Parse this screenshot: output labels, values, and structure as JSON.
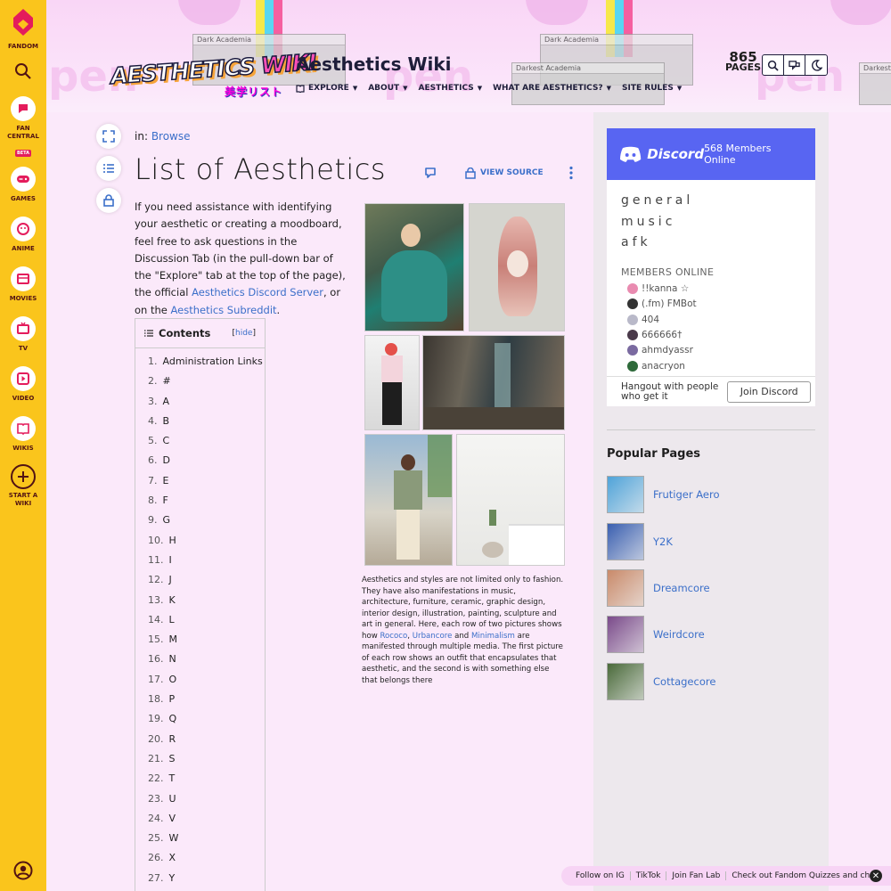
{
  "rail": {
    "fandom_label": "FANDOM",
    "fan_central_label": "FAN CENTRAL",
    "beta_badge": "BETA",
    "games_label": "GAMES",
    "anime_label": "ANIME",
    "movies_label": "MOVIES",
    "tv_label": "TV",
    "video_label": "VIDEO",
    "wikis_label": "WIKIS",
    "start_wiki_label": "START A WIKI"
  },
  "header": {
    "logo_text_a": "AESTHETICS",
    "logo_text_b": "WIKI",
    "logo_sub": "美学リスト",
    "wiki_name": "Aesthetics Wiki",
    "nav": {
      "explore": "EXPLORE",
      "about": "ABOUT",
      "aesthetics": "AESTHETICS",
      "what_are": "WHAT ARE AESTHETICS?",
      "site_rules": "SITE RULES"
    },
    "pages_count": "865",
    "pages_label": "PAGES",
    "deco_window_1": "Dark Academia",
    "deco_window_2": "Dark Academia",
    "deco_window_3": "Darkest Academia",
    "deco_window_4": "Darkest"
  },
  "article": {
    "breadcrumb_prefix": "in:",
    "breadcrumb_link": "Browse",
    "title": "List of Aesthetics",
    "view_source": "VIEW SOURCE",
    "intro_text": "If you need assistance with identifying your aesthetic or creating a moodboard, feel free to ask questions in the Discussion Tab (in the pull-down bar of the \"Explore\" tab at the top of the page), the official ",
    "intro_link1": "Aesthetics Discord Server",
    "intro_mid": ", or on the ",
    "intro_link2": "Aesthetics Subreddit",
    "intro_end": ".",
    "caption_a": "Aesthetics and styles are not limited only to fashion. They have also manifestations in music, architecture, furniture, ceramic, graphic design, interior design, illustration, painting, sculpture and art in general. Here, each row of two pictures shows how ",
    "caption_link1": "Rococo",
    "caption_sep": ", ",
    "caption_link2": "Urbancore",
    "caption_and": " and ",
    "caption_link3": "Minimalism",
    "caption_b": " are manifested through multiple media. The first picture of each row shows an outfit that encapsulates that aesthetic, and the second is with something else that belongs there"
  },
  "toc": {
    "title": "Contents",
    "hide": "hide",
    "items": [
      {
        "num": "1.",
        "label": "Administration Links"
      },
      {
        "num": "2.",
        "label": "#"
      },
      {
        "num": "3.",
        "label": "A"
      },
      {
        "num": "4.",
        "label": "B"
      },
      {
        "num": "5.",
        "label": "C"
      },
      {
        "num": "6.",
        "label": "D"
      },
      {
        "num": "7.",
        "label": "E"
      },
      {
        "num": "8.",
        "label": "F"
      },
      {
        "num": "9.",
        "label": "G"
      },
      {
        "num": "10.",
        "label": "H"
      },
      {
        "num": "11.",
        "label": "I"
      },
      {
        "num": "12.",
        "label": "J"
      },
      {
        "num": "13.",
        "label": "K"
      },
      {
        "num": "14.",
        "label": "L"
      },
      {
        "num": "15.",
        "label": "M"
      },
      {
        "num": "16.",
        "label": "N"
      },
      {
        "num": "17.",
        "label": "O"
      },
      {
        "num": "18.",
        "label": "P"
      },
      {
        "num": "19.",
        "label": "Q"
      },
      {
        "num": "20.",
        "label": "R"
      },
      {
        "num": "21.",
        "label": "S"
      },
      {
        "num": "22.",
        "label": "T"
      },
      {
        "num": "23.",
        "label": "U"
      },
      {
        "num": "24.",
        "label": "V"
      },
      {
        "num": "25.",
        "label": "W"
      },
      {
        "num": "26.",
        "label": "X"
      },
      {
        "num": "27.",
        "label": "Y"
      }
    ]
  },
  "discord": {
    "logo": "Discord",
    "online": "568 Members Online",
    "channels": [
      "general",
      "music",
      "afk"
    ],
    "members_online_label": "MEMBERS ONLINE",
    "members": [
      {
        "name": "!!kanna ☆",
        "color": "#e98bb0"
      },
      {
        "name": "(.fm) FMBot",
        "color": "#333333"
      },
      {
        "name": "404",
        "color": "#b9b9c9"
      },
      {
        "name": "666666†",
        "color": "#4a3a4a"
      },
      {
        "name": "ahmdyassr",
        "color": "#7a6aa0"
      },
      {
        "name": "anacryon",
        "color": "#2e6a3a"
      }
    ],
    "hangout": "Hangout with people who get it",
    "join": "Join Discord"
  },
  "popular": {
    "title": "Popular Pages",
    "items": [
      {
        "label": "Frutiger Aero",
        "color": "#4fa3d9"
      },
      {
        "label": "Y2K",
        "color": "#3a5fb0"
      },
      {
        "label": "Dreamcore",
        "color": "#c98a6a"
      },
      {
        "label": "Weirdcore",
        "color": "#7a4a8a"
      },
      {
        "label": "Cottagecore",
        "color": "#4a6a3a"
      }
    ]
  },
  "footer_bar": {
    "items": [
      "Follow on IG",
      "TikTok",
      "Join Fan Lab",
      "Check out Fandom Quizzes and cha"
    ]
  },
  "colors": {
    "rail": "#fac51c",
    "link": "#3b6fc9",
    "discord": "#5865f2"
  }
}
